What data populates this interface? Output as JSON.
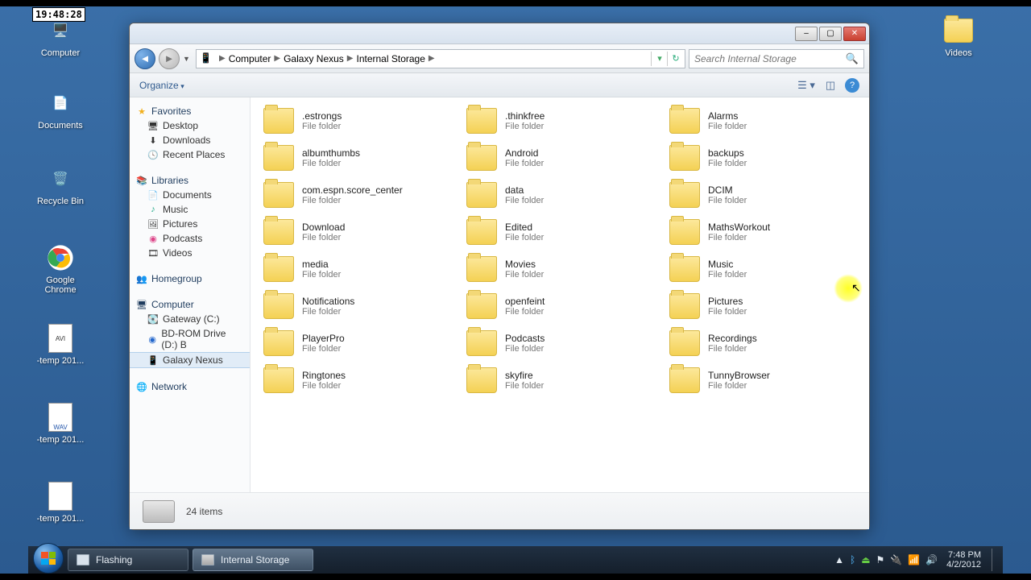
{
  "clock_overlay": "19:48:28",
  "desktop": {
    "computer": "Computer",
    "documents": "Documents",
    "recycle": "Recycle Bin",
    "chrome": "Google Chrome",
    "temp1": "-temp 201...",
    "temp2": "-temp 201...",
    "temp3": "-temp 201...",
    "videos": "Videos"
  },
  "window": {
    "breadcrumb": [
      "Computer",
      "Galaxy Nexus",
      "Internal Storage"
    ],
    "search_placeholder": "Search Internal Storage",
    "organize": "Organize",
    "status": "24 items",
    "file_type": "File folder",
    "folders": [
      ".estrongs",
      ".thinkfree",
      "Alarms",
      "albumthumbs",
      "Android",
      "backups",
      "com.espn.score_center",
      "data",
      "DCIM",
      "Download",
      "Edited",
      "MathsWorkout",
      "media",
      "Movies",
      "Music",
      "Notifications",
      "openfeint",
      "Pictures",
      "PlayerPro",
      "Podcasts",
      "Recordings",
      "Ringtones",
      "skyfire",
      "TunnyBrowser"
    ]
  },
  "sidebar": {
    "favorites": {
      "head": "Favorites",
      "items": [
        "Desktop",
        "Downloads",
        "Recent Places"
      ]
    },
    "libraries": {
      "head": "Libraries",
      "items": [
        "Documents",
        "Music",
        "Pictures",
        "Podcasts",
        "Videos"
      ]
    },
    "homegroup": "Homegroup",
    "computer": {
      "head": "Computer",
      "items": [
        "Gateway (C:)",
        "BD-ROM Drive (D:) B",
        "Galaxy Nexus"
      ]
    },
    "network": "Network"
  },
  "taskbar": {
    "flashing": "Flashing",
    "internal": "Internal Storage",
    "time": "7:48 PM",
    "date": "4/2/2012"
  }
}
